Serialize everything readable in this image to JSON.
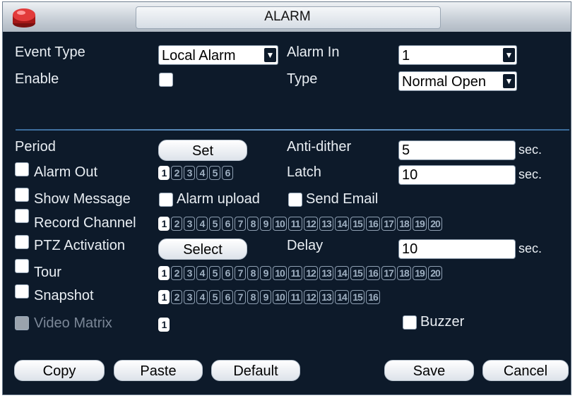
{
  "title": "ALARM",
  "event_type": {
    "label": "Event Type",
    "value": "Local Alarm"
  },
  "alarm_in": {
    "label": "Alarm In",
    "value": "1"
  },
  "enable": {
    "label": "Enable"
  },
  "type": {
    "label": "Type",
    "value": "Normal Open"
  },
  "period": {
    "label": "Period",
    "button": "Set"
  },
  "anti_dither": {
    "label": "Anti-dither",
    "value": "5",
    "unit": "sec."
  },
  "alarm_out": {
    "label": "Alarm Out",
    "channels": [
      "1",
      "2",
      "3",
      "4",
      "5",
      "6"
    ],
    "selected": [
      "1"
    ]
  },
  "latch": {
    "label": "Latch",
    "value": "10",
    "unit": "sec."
  },
  "show_message": {
    "label": "Show Message"
  },
  "alarm_upload": {
    "label": "Alarm upload"
  },
  "send_email": {
    "label": "Send Email"
  },
  "record_channel": {
    "label": "Record Channel",
    "channels": [
      "1",
      "2",
      "3",
      "4",
      "5",
      "6",
      "7",
      "8",
      "9",
      "10",
      "11",
      "12",
      "13",
      "14",
      "15",
      "16",
      "17",
      "18",
      "19",
      "20"
    ],
    "selected": [
      "1"
    ]
  },
  "ptz": {
    "label": "PTZ Activation",
    "button": "Select"
  },
  "delay": {
    "label": "Delay",
    "value": "10",
    "unit": "sec."
  },
  "tour": {
    "label": "Tour",
    "channels": [
      "1",
      "2",
      "3",
      "4",
      "5",
      "6",
      "7",
      "8",
      "9",
      "10",
      "11",
      "12",
      "13",
      "14",
      "15",
      "16",
      "17",
      "18",
      "19",
      "20"
    ],
    "selected": [
      "1"
    ]
  },
  "snapshot": {
    "label": "Snapshot",
    "channels": [
      "1",
      "2",
      "3",
      "4",
      "5",
      "6",
      "7",
      "8",
      "9",
      "10",
      "11",
      "12",
      "13",
      "14",
      "15",
      "16"
    ],
    "selected": [
      "1"
    ]
  },
  "video_matrix": {
    "label": "Video Matrix",
    "channels": [
      "1"
    ],
    "selected": [
      "1"
    ]
  },
  "buzzer": {
    "label": "Buzzer"
  },
  "buttons": {
    "copy": "Copy",
    "paste": "Paste",
    "default": "Default",
    "save": "Save",
    "cancel": "Cancel"
  },
  "colors": {
    "background": "#0d1a2a",
    "separator": "#6fa0cf"
  }
}
